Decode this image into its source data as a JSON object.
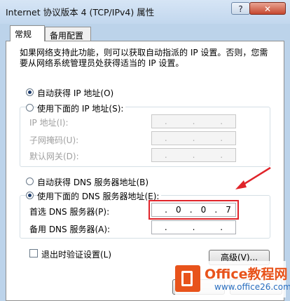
{
  "window": {
    "title": "Internet 协议版本 4 (TCP/IPv4) 属性",
    "help_label": "?",
    "close_label": "✕"
  },
  "tabs": [
    {
      "label": "常规",
      "active": true
    },
    {
      "label": "备用配置",
      "active": false
    }
  ],
  "description": "如果网络支持此功能，则可以获取自动指派的 IP 设置。否则，您需要从网络系统管理员处获得适当的 IP 设置。",
  "ip": {
    "auto_label": "自动获得 IP 地址(O)",
    "manual_label": "使用下面的 IP 地址(S):",
    "auto_selected": true,
    "fields": [
      {
        "label": "IP 地址(I):",
        "value": ". . ."
      },
      {
        "label": "子网掩码(U):",
        "value": ". . ."
      },
      {
        "label": "默认网关(D):",
        "value": ". . ."
      }
    ]
  },
  "dns": {
    "auto_label": "自动获得 DNS 服务器地址(B)",
    "manual_label": "使用下面的 DNS 服务器地址(E):",
    "manual_selected": true,
    "preferred": {
      "label": "首选 DNS 服务器(P):",
      "octets": [
        "",
        "0",
        "0",
        "7"
      ]
    },
    "alternate": {
      "label": "备用 DNS 服务器(A):",
      "octets": [
        "",
        "",
        "",
        ""
      ]
    }
  },
  "validate_label": "退出时验证设置(L)",
  "advanced_label": "高级(V)...",
  "watermark": {
    "brand": "Office教程网",
    "url": "www.office26.com"
  },
  "colors": {
    "highlight": "#e0242a",
    "watermark": "#e8531b"
  }
}
